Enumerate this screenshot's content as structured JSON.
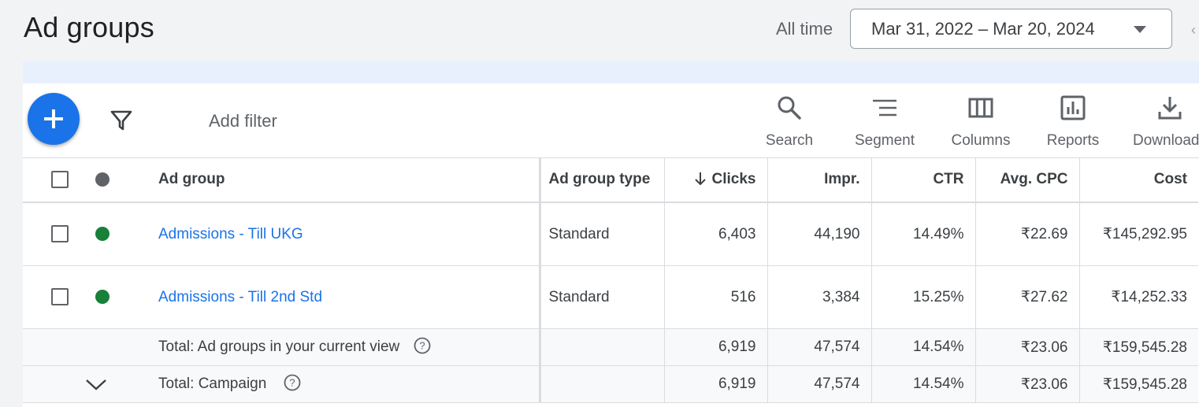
{
  "header": {
    "title": "Ad groups",
    "date_preset": "All time",
    "date_range": "Mar 31, 2022 – Mar 20, 2024"
  },
  "toolbar": {
    "add_filter": "Add filter",
    "tools": [
      {
        "label": "Search",
        "icon": "search-icon"
      },
      {
        "label": "Segment",
        "icon": "segment-icon"
      },
      {
        "label": "Columns",
        "icon": "columns-icon"
      },
      {
        "label": "Reports",
        "icon": "reports-icon"
      },
      {
        "label": "Download",
        "icon": "download-icon"
      }
    ]
  },
  "table": {
    "columns": [
      "Ad group",
      "Ad group type",
      "Clicks",
      "Impr.",
      "CTR",
      "Avg. CPC",
      "Cost"
    ],
    "sorted_column": "Clicks",
    "sort_direction": "descending",
    "rows": [
      {
        "status": "enabled",
        "name": "Admissions - Till UKG",
        "type": "Standard",
        "clicks": "6,403",
        "impr": "44,190",
        "ctr": "14.49%",
        "cpc": "₹22.69",
        "cost": "₹145,292.95"
      },
      {
        "status": "enabled",
        "name": "Admissions - Till 2nd Std",
        "type": "Standard",
        "clicks": "516",
        "impr": "3,384",
        "ctr": "15.25%",
        "cpc": "₹27.62",
        "cost": "₹14,252.33"
      }
    ],
    "totals": [
      {
        "label": "Total: Ad groups in your current view",
        "clicks": "6,919",
        "impr": "47,574",
        "ctr": "14.54%",
        "cpc": "₹23.06",
        "cost": "₹159,545.28"
      },
      {
        "label": "Total: Campaign",
        "clicks": "6,919",
        "impr": "47,574",
        "ctr": "14.54%",
        "cpc": "₹23.06",
        "cost": "₹159,545.28"
      }
    ]
  },
  "colors": {
    "accent": "#1a73e8",
    "status_enabled": "#188038",
    "banner": "#e8f0fe"
  }
}
